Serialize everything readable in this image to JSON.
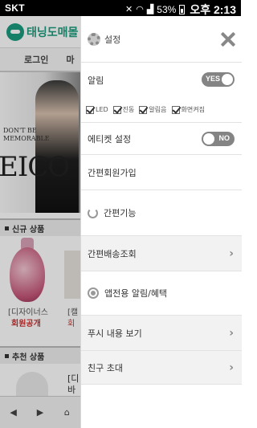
{
  "status_bar": {
    "carrier": "SKT",
    "battery": "53%",
    "time": "오후 2:13"
  },
  "background_app": {
    "logo_text": "태닝도매몰",
    "tabs": [
      "로그인",
      "마"
    ],
    "hero_small_text": "DON'T BE MEMORABLE",
    "hero_big_text": "EICO",
    "section_new": "신규 상품",
    "product_name": "[디자이너스",
    "product_price": "회원공개",
    "product2_name": "[캘",
    "product2_price": "회",
    "section_recommend": "추천 상품",
    "product3_line1": "[디",
    "product3_line2": "바"
  },
  "drawer": {
    "header_label": "설정",
    "notification_label": "알림",
    "notification_toggle": "YES",
    "checkboxes": [
      "LED",
      "진동",
      "알림음",
      "화면켜짐"
    ],
    "etiquette_label": "에티켓 설정",
    "etiquette_toggle": "NO",
    "signup_label": "간편회원가입",
    "easy_label": "간편기능",
    "delivery_label": "간편배송조회",
    "app_alert_label": "앱전용 알림/혜택",
    "push_label": "푸시 내용 보기",
    "invite_label": "친구 초대"
  }
}
